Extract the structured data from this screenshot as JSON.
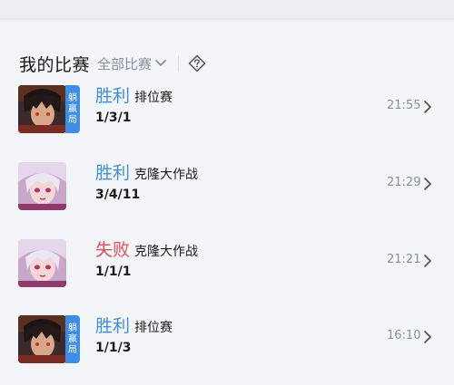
{
  "header": {
    "title": "我的比赛",
    "filter_label": "全部比赛"
  },
  "matches": [
    {
      "result": "胜利",
      "mode": "排位赛",
      "kda": "1/3/1",
      "time": "21:55",
      "tag": [
        "躺",
        "赢",
        "局"
      ]
    },
    {
      "result": "胜利",
      "mode": "克隆大作战",
      "kda": "3/4/11",
      "time": "21:29"
    },
    {
      "result": "失败",
      "mode": "克隆大作战",
      "kda": "1/1/1",
      "time": "21:21"
    },
    {
      "result": "胜利",
      "mode": "排位赛",
      "kda": "1/1/3",
      "time": "16:10",
      "tag": [
        "躺",
        "赢",
        "局"
      ]
    }
  ],
  "colors": {
    "win": "#3d8fdc",
    "lose": "#e0505a",
    "tag": "#3f8ee5"
  },
  "icons": {
    "filter": "chevron-down-icon",
    "help": "help-diamond-icon",
    "row": "chevron-right-icon"
  }
}
